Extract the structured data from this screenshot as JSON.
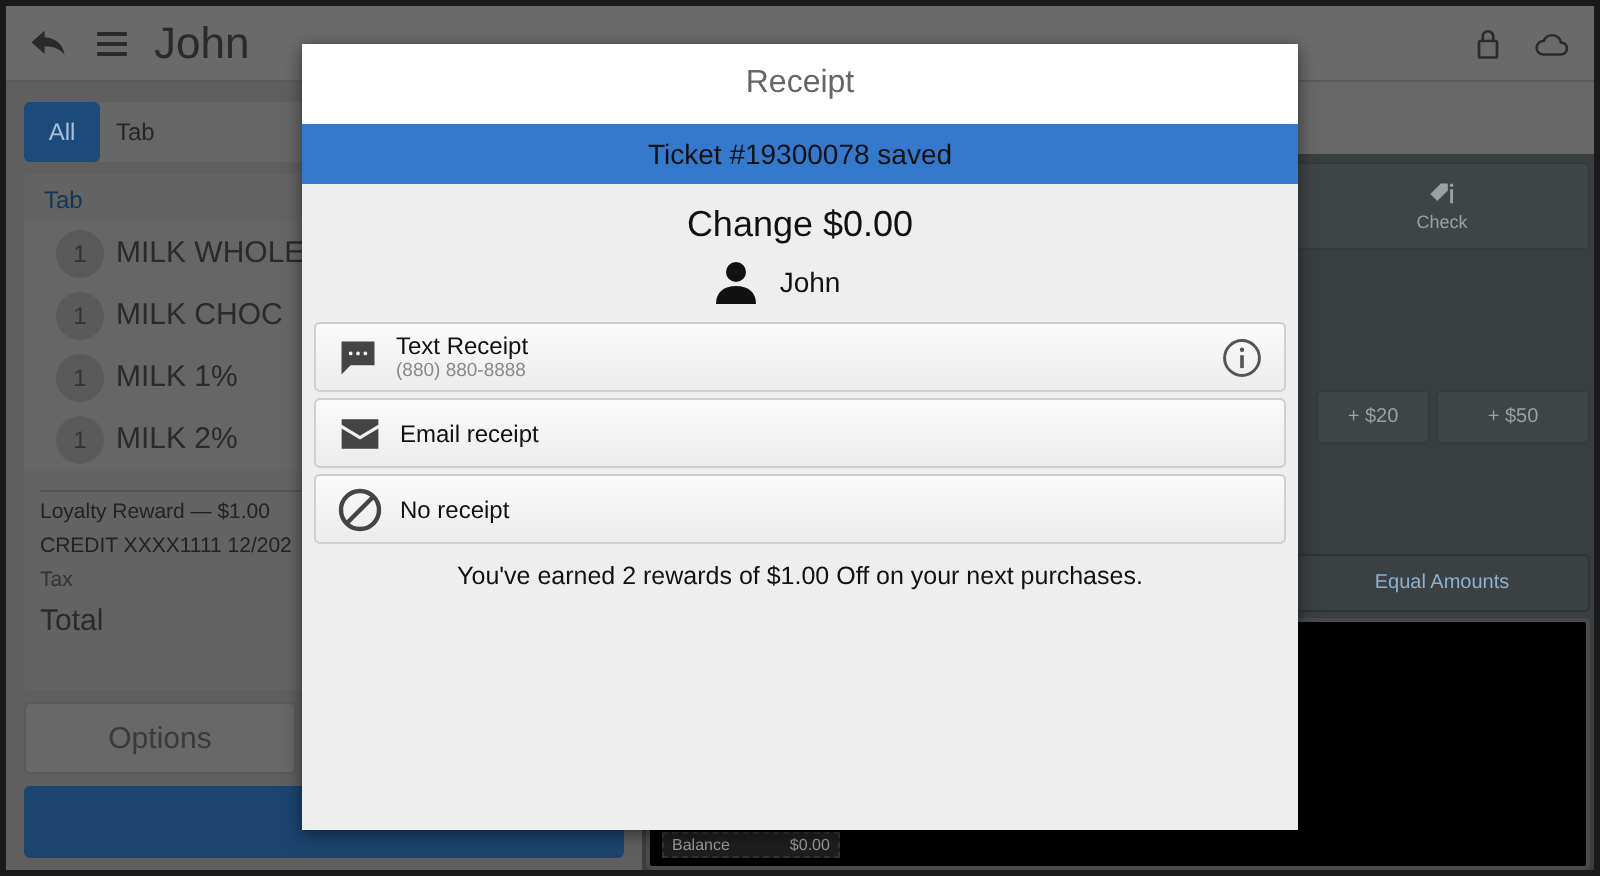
{
  "header": {
    "title": "John"
  },
  "tabs": [
    {
      "label": "All",
      "selected": true
    },
    {
      "label": "Tab",
      "selected": false
    }
  ],
  "order": {
    "section": "Tab",
    "items": [
      {
        "qty": "1",
        "name": "MILK WHOLE"
      },
      {
        "qty": "1",
        "name": "MILK CHOC"
      },
      {
        "qty": "1",
        "name": "MILK 1%"
      },
      {
        "qty": "1",
        "name": "MILK 2%"
      }
    ],
    "summary": [
      "Loyalty Reward — $1.00",
      "CREDIT XXXX1111 12/202",
      "Tax"
    ],
    "total_label": "Total"
  },
  "buttons": {
    "options": "Options"
  },
  "payment": {
    "tender": "Check",
    "quick_amounts": [
      "+ $20",
      "+ $50"
    ],
    "split": "Equal Amounts",
    "balance_label": "Balance",
    "balance_value": "$0.00"
  },
  "modal": {
    "title": "Receipt",
    "banner": "Ticket #19300078 saved",
    "change": "Change $0.00",
    "customer": "John",
    "options": [
      {
        "kind": "text",
        "label": "Text Receipt",
        "detail": "(880) 880-8888"
      },
      {
        "kind": "email",
        "label": "Email receipt"
      },
      {
        "kind": "none",
        "label": "No receipt"
      }
    ],
    "message": "You've earned 2 rewards of $1.00 Off on your next purchases."
  }
}
